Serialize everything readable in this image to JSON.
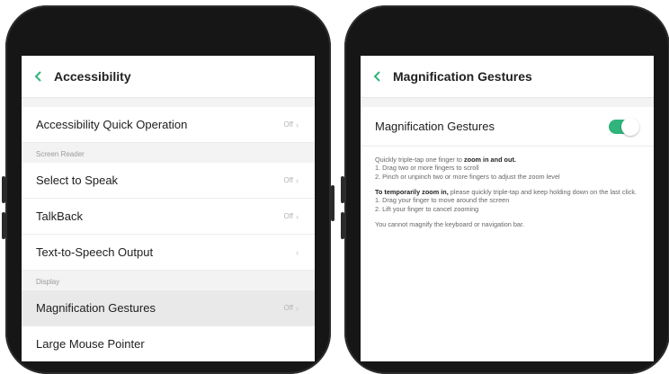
{
  "left_screen": {
    "title": "Accessibility",
    "quick_operation": {
      "label": "Accessibility Quick Operation",
      "value": "Off"
    },
    "section_screen_reader": "Screen Reader",
    "select_to_speak": {
      "label": "Select to Speak",
      "value": "Off"
    },
    "talkback": {
      "label": "TalkBack",
      "value": "Off"
    },
    "tts_output": {
      "label": "Text-to-Speech Output"
    },
    "section_display": "Display",
    "magnification": {
      "label": "Magnification Gestures",
      "value": "Off"
    },
    "partial_row": {
      "label": "Large Mouse Pointer"
    }
  },
  "right_screen": {
    "title": "Magnification Gestures",
    "toggle": {
      "label": "Magnification Gestures",
      "state": "on",
      "color": "#2fb47c"
    },
    "desc": {
      "intro_prefix": "Quickly triple-tap one finger to ",
      "intro_bold": "zoom in and out.",
      "step1": "1. Drag two or more fingers to scroll",
      "step2": "2. Pinch or unpinch two or more fingers to adjust the zoom level",
      "temp_bold": "To temporarily zoom in,",
      "temp_rest": " please quickly triple-tap and keep holding down on the last click.",
      "temp_step1": "1. Drag your finger to move around the screen",
      "temp_step2": "2. Lift your finger to cancel zooming",
      "note": "You cannot magnify the keyboard or navigation bar."
    }
  },
  "icons": {
    "back": "chevron-left-icon",
    "row_arrow": "chevron-right-icon"
  },
  "colors": {
    "accent": "#2fb47c",
    "back_arrow": "#2fb47c"
  }
}
